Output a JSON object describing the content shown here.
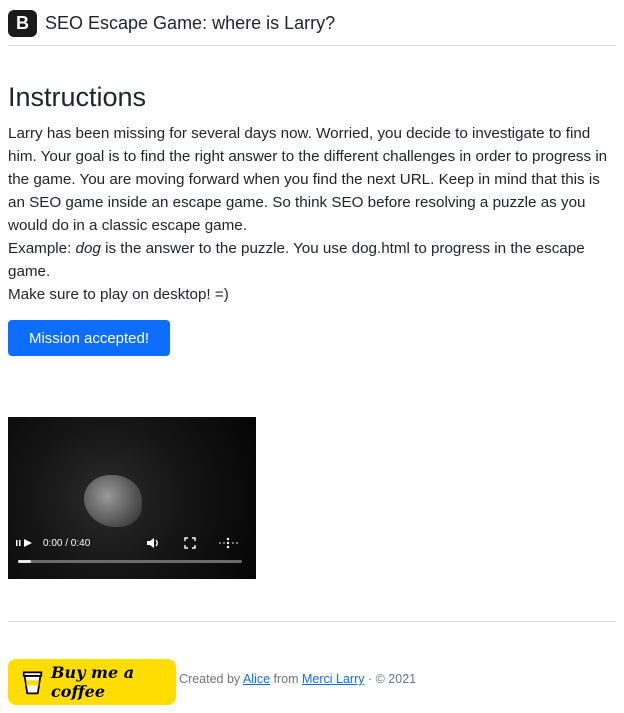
{
  "header": {
    "logo_letter": "B",
    "title": "SEO Escape Game: where is Larry?"
  },
  "main": {
    "heading": "Instructions",
    "paragraph1": "Larry has been missing for several days now. Worried, you decide to investigate to find him. Your goal is to find the right answer to the different challenges in order to progress in the game. You are moving forward when you find the next URL. Keep in mind that this is an SEO game inside an escape game. So think SEO before resolving a puzzle as you would do in a classic escape game.",
    "example_prefix": "Example: ",
    "example_word": "dog",
    "example_suffix": " is the answer to the puzzle. You use dog.html to progress in the escape game.",
    "desktop_note": "Make sure to play on desktop! =)",
    "button_label": "Mission accepted!"
  },
  "video": {
    "time": "0:00 / 0:40",
    "progress": 0.06
  },
  "footer": {
    "coffee_label": "Buy me a coffee",
    "created_by": "Created by ",
    "author_link": "Alice",
    "from_text": " from ",
    "site_link": "Merci Larry",
    "copyright": " · © 2021"
  },
  "colors": {
    "primary": "#0d6efd",
    "coffee_bg": "#ffdd00"
  }
}
